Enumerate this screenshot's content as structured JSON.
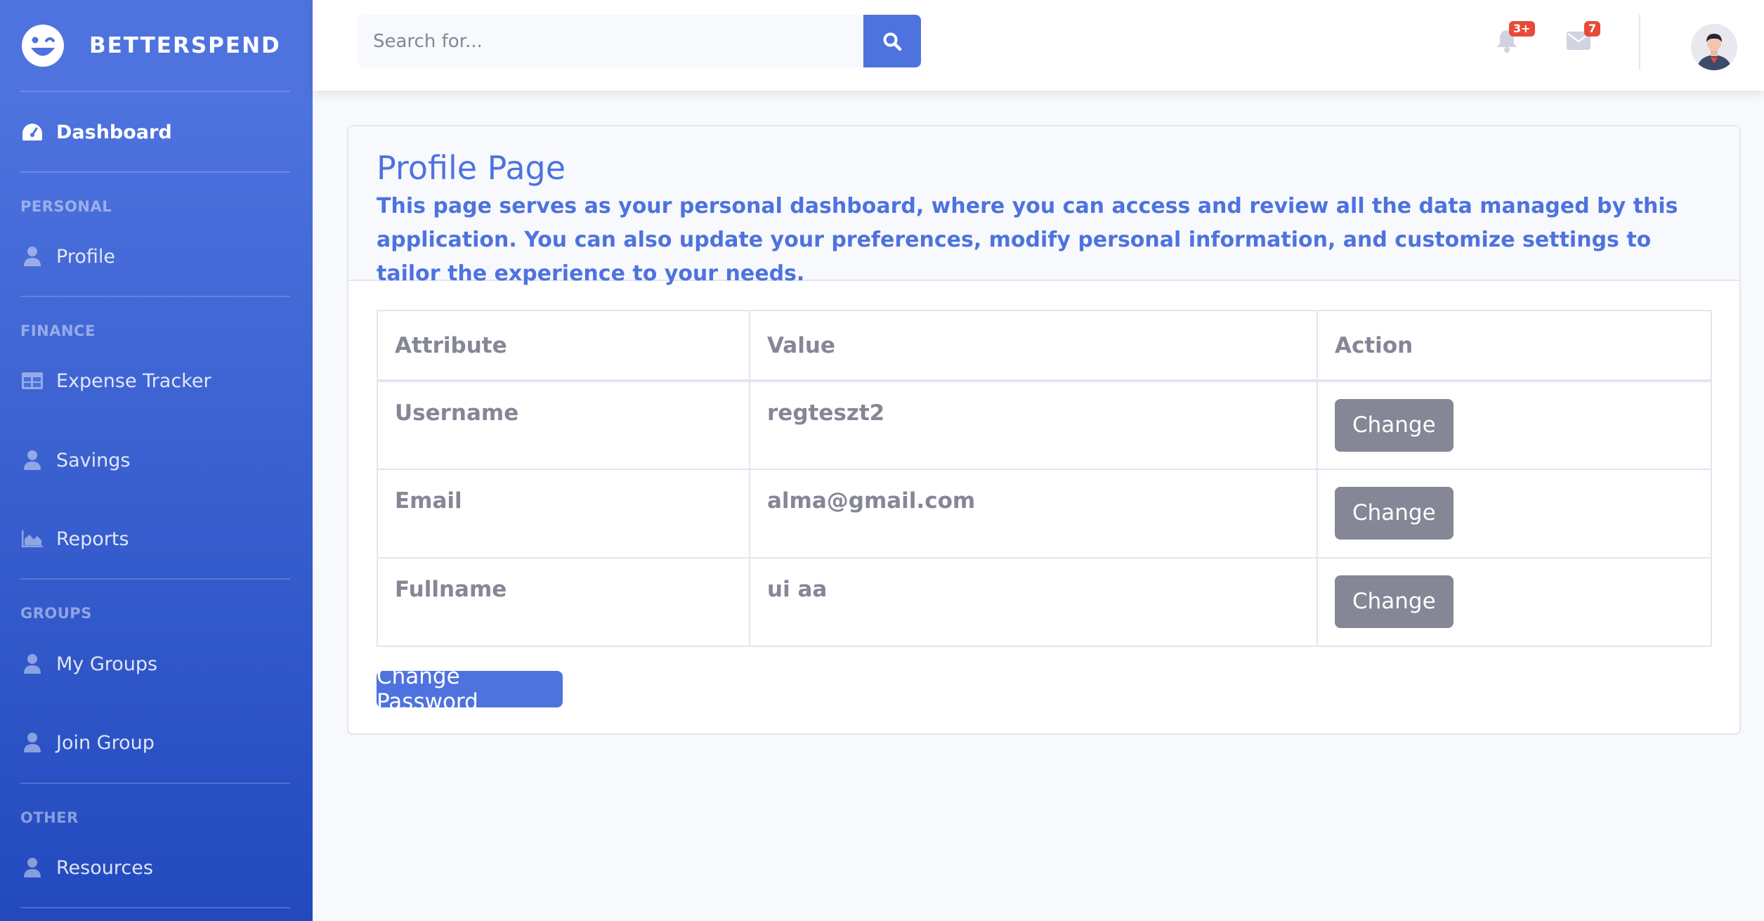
{
  "brand": {
    "name": "BETTERSPEND"
  },
  "sidebar": {
    "dashboard": "Dashboard",
    "sections": [
      {
        "heading": "PERSONAL"
      },
      {
        "heading": "FINANCE"
      },
      {
        "heading": "GROUPS"
      },
      {
        "heading": "OTHER"
      }
    ],
    "items": [
      {
        "label": "Profile",
        "icon": "user-icon"
      },
      {
        "label": "Expense Tracker",
        "icon": "table-icon"
      },
      {
        "label": "Savings",
        "icon": "user-icon"
      },
      {
        "label": "Reports",
        "icon": "chart-area-icon"
      },
      {
        "label": "My Groups",
        "icon": "user-icon"
      },
      {
        "label": "Join Group",
        "icon": "user-icon"
      },
      {
        "label": "Resources",
        "icon": "user-icon"
      }
    ]
  },
  "topbar": {
    "search_placeholder": "Search for...",
    "alerts_badge": "3+",
    "messages_badge": "7"
  },
  "card": {
    "title": "Profile Page",
    "description": "This page serves as your personal dashboard, where you can access and review all the data managed by this application. You can also update your preferences, modify personal information, and customize settings to tailor the experience to your needs."
  },
  "table": {
    "headers": [
      "Attribute",
      "Value",
      "Action"
    ],
    "rows": [
      {
        "attribute": "Username",
        "value": "regteszt2",
        "action": "Change"
      },
      {
        "attribute": "Email",
        "value": "alma@gmail.com",
        "action": "Change"
      },
      {
        "attribute": "Fullname",
        "value": "ui aa",
        "action": "Change"
      }
    ]
  },
  "change_password_label": "Change Password",
  "colors": {
    "primary": "#4e73df",
    "secondary": "#858796",
    "danger": "#e74a3b"
  }
}
